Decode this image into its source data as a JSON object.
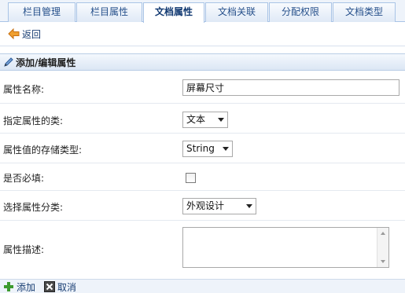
{
  "tabs": [
    {
      "label": "栏目管理",
      "active": false
    },
    {
      "label": "栏目属性",
      "active": false
    },
    {
      "label": "文档属性",
      "active": true
    },
    {
      "label": "文档关联",
      "active": false
    },
    {
      "label": "分配权限",
      "active": false
    },
    {
      "label": "文档类型",
      "active": false
    }
  ],
  "back": {
    "label": "返回",
    "icon": "back-arrow-icon"
  },
  "section": {
    "title": "添加/编辑属性",
    "icon": "pencil-icon"
  },
  "form": {
    "name": {
      "label": "属性名称:",
      "value": "屏幕尺寸"
    },
    "kind": {
      "label": "指定属性的类:",
      "selected": "文本"
    },
    "storage": {
      "label": "属性值的存储类型:",
      "selected": "String"
    },
    "required": {
      "label": "是否必填:",
      "checked": false
    },
    "category": {
      "label": "选择属性分类:",
      "selected": "外观设计"
    },
    "description": {
      "label": "属性描述:",
      "value": ""
    }
  },
  "footer": {
    "add_label": "添加",
    "cancel_label": "取消"
  },
  "colors": {
    "tab_border": "#a9c4e6",
    "link": "#1a3f74",
    "add_icon": "#3c9a2e",
    "back_icon": "#e98a1a"
  }
}
